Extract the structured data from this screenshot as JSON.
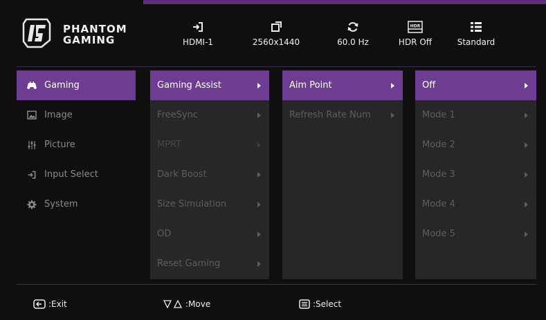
{
  "brand": {
    "line1": "PHANTOM",
    "line2": "GAMING"
  },
  "status": [
    {
      "label": "HDMI-1",
      "icon": "input-icon"
    },
    {
      "label": "2560x1440",
      "icon": "resolution-icon"
    },
    {
      "label": "60.0 Hz",
      "icon": "refresh-icon"
    },
    {
      "label": "HDR Off",
      "icon": "hdr-icon",
      "badge": "HDR"
    },
    {
      "label": "Standard",
      "icon": "list-icon"
    }
  ],
  "left_menu": [
    {
      "label": "Gaming",
      "icon": "gamepad-icon",
      "active": true
    },
    {
      "label": "Image",
      "icon": "image-icon"
    },
    {
      "label": "Picture",
      "icon": "sliders-icon"
    },
    {
      "label": "Input Select",
      "icon": "input-icon"
    },
    {
      "label": "System",
      "icon": "gear-icon"
    }
  ],
  "col1": [
    {
      "label": "Gaming Assist",
      "active": true
    },
    {
      "label": "FreeSync"
    },
    {
      "label": "MPRT",
      "disabled": true
    },
    {
      "label": "Dark Boost"
    },
    {
      "label": "Size Simulation"
    },
    {
      "label": "OD"
    },
    {
      "label": "Reset Gaming"
    }
  ],
  "col2": [
    {
      "label": "Aim Point",
      "active": true
    },
    {
      "label": "Refresh Rate Num"
    }
  ],
  "col3": [
    {
      "label": "Off",
      "active": true
    },
    {
      "label": "Mode 1"
    },
    {
      "label": "Mode 2"
    },
    {
      "label": "Mode 3"
    },
    {
      "label": "Mode 4"
    },
    {
      "label": "Mode 5"
    }
  ],
  "footer": {
    "exit": ":Exit",
    "move": ":Move",
    "select": ":Select"
  },
  "colors": {
    "accent": "#6e3d91",
    "panel": "#272727",
    "bg": "#0f0f0f"
  }
}
